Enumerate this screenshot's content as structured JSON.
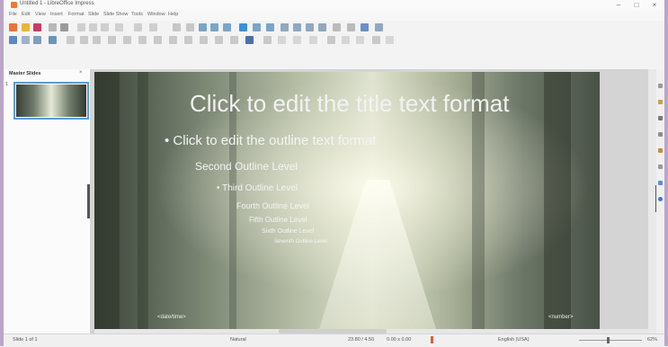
{
  "window": {
    "title": "Untitled 1 - LibreOffice Impress",
    "controls": [
      "–",
      "□",
      "×"
    ]
  },
  "menubar": {
    "items": [
      "File",
      "Edit",
      "View",
      "Insert",
      "Format",
      "Slide",
      "Slide Show",
      "Tools",
      "Window",
      "Help"
    ]
  },
  "slide_pane": {
    "title": "Master Slides",
    "close": "×",
    "thumbnail_number": "1"
  },
  "slide": {
    "title": "Click to edit the title text format",
    "outline": [
      {
        "text": "• Click to edit the outline text format",
        "level": 1
      },
      {
        "text": "Second Outline Level",
        "level": 2
      },
      {
        "text": "• Third Outline Level",
        "level": 3
      },
      {
        "text": "Fourth Outline Level",
        "level": 4
      },
      {
        "text": "Fifth Outline Level",
        "level": 5
      },
      {
        "text": "Sixth Outline Level",
        "level": 6
      },
      {
        "text": "Seventh Outline Level",
        "level": 7
      }
    ],
    "footer_left": "<date/time>",
    "footer_right": "<number>"
  },
  "statusbar": {
    "slide_info": "Slide 1 of 1",
    "layout_name": "Natural",
    "position": "23.80 / 4.50",
    "size": "0.00 x 0.00",
    "language": "English (USA)",
    "zoom": "62%"
  }
}
